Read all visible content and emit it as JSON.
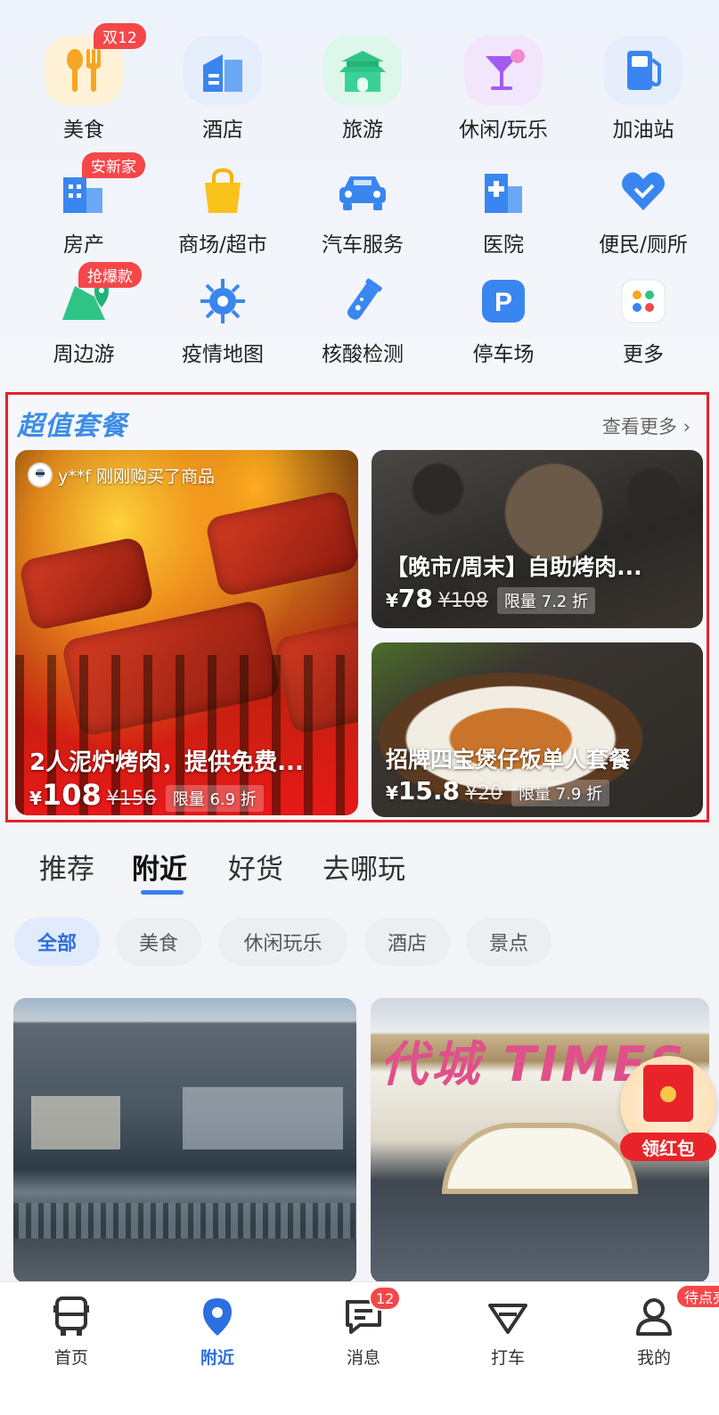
{
  "categories": [
    {
      "label": "美食",
      "icon": "food-icon",
      "badge": "双12"
    },
    {
      "label": "酒店",
      "icon": "hotel-icon",
      "badge": ""
    },
    {
      "label": "旅游",
      "icon": "travel-icon",
      "badge": ""
    },
    {
      "label": "休闲/玩乐",
      "icon": "cocktail-icon",
      "badge": ""
    },
    {
      "label": "加油站",
      "icon": "gas-station-icon",
      "badge": ""
    },
    {
      "label": "房产",
      "icon": "real-estate-icon",
      "badge": "安新家"
    },
    {
      "label": "商场/超市",
      "icon": "shopping-bag-icon",
      "badge": ""
    },
    {
      "label": "汽车服务",
      "icon": "car-icon",
      "badge": ""
    },
    {
      "label": "医院",
      "icon": "hospital-icon",
      "badge": ""
    },
    {
      "label": "便民/厕所",
      "icon": "heart-hand-icon",
      "badge": ""
    },
    {
      "label": "周边游",
      "icon": "map-pin-icon",
      "badge": "抢爆款"
    },
    {
      "label": "疫情地图",
      "icon": "virus-icon",
      "badge": ""
    },
    {
      "label": "核酸检测",
      "icon": "test-tube-icon",
      "badge": ""
    },
    {
      "label": "停车场",
      "icon": "parking-icon",
      "badge": ""
    },
    {
      "label": "更多",
      "icon": "more-dots-icon",
      "badge": ""
    }
  ],
  "package": {
    "title": "超值套餐",
    "more": "查看更多 ›",
    "main": {
      "buyer": "y**f 刚刚购买了商品",
      "name": "2人泥炉烤肉，提供免费...",
      "yen": "¥",
      "price": "108",
      "old_price": "¥156",
      "tag": "限量 6.9 折"
    },
    "top_right": {
      "name": "【晚市/周末】自助烤肉...",
      "yen": "¥",
      "price": "78",
      "old_price": "¥108",
      "tag": "限量 7.2 折"
    },
    "bottom_right": {
      "name": "招牌四宝煲仔饭单人套餐",
      "yen": "¥",
      "price": "15.8",
      "old_price": "¥20",
      "tag": "限量 7.9 折"
    }
  },
  "tabs": [
    "推荐",
    "附近",
    "好货",
    "去哪玩"
  ],
  "active_tab": "附近",
  "chips": [
    "全部",
    "美食",
    "休闲玩乐",
    "酒店",
    "景点"
  ],
  "feed": {
    "right_sign": "代城 TIMES"
  },
  "red_packet": "领红包",
  "nav": [
    {
      "label": "首页",
      "icon": "bus-icon",
      "badge": ""
    },
    {
      "label": "附近",
      "icon": "location-pin-icon",
      "badge": ""
    },
    {
      "label": "消息",
      "icon": "message-icon",
      "badge": "12"
    },
    {
      "label": "打车",
      "icon": "taxi-icon",
      "badge": ""
    },
    {
      "label": "我的",
      "icon": "user-icon",
      "badge": "待点亮"
    }
  ],
  "colors": {
    "accent": "#2b6fe0",
    "badge_red": "#f5474a",
    "highlight_border": "#e8202a"
  }
}
